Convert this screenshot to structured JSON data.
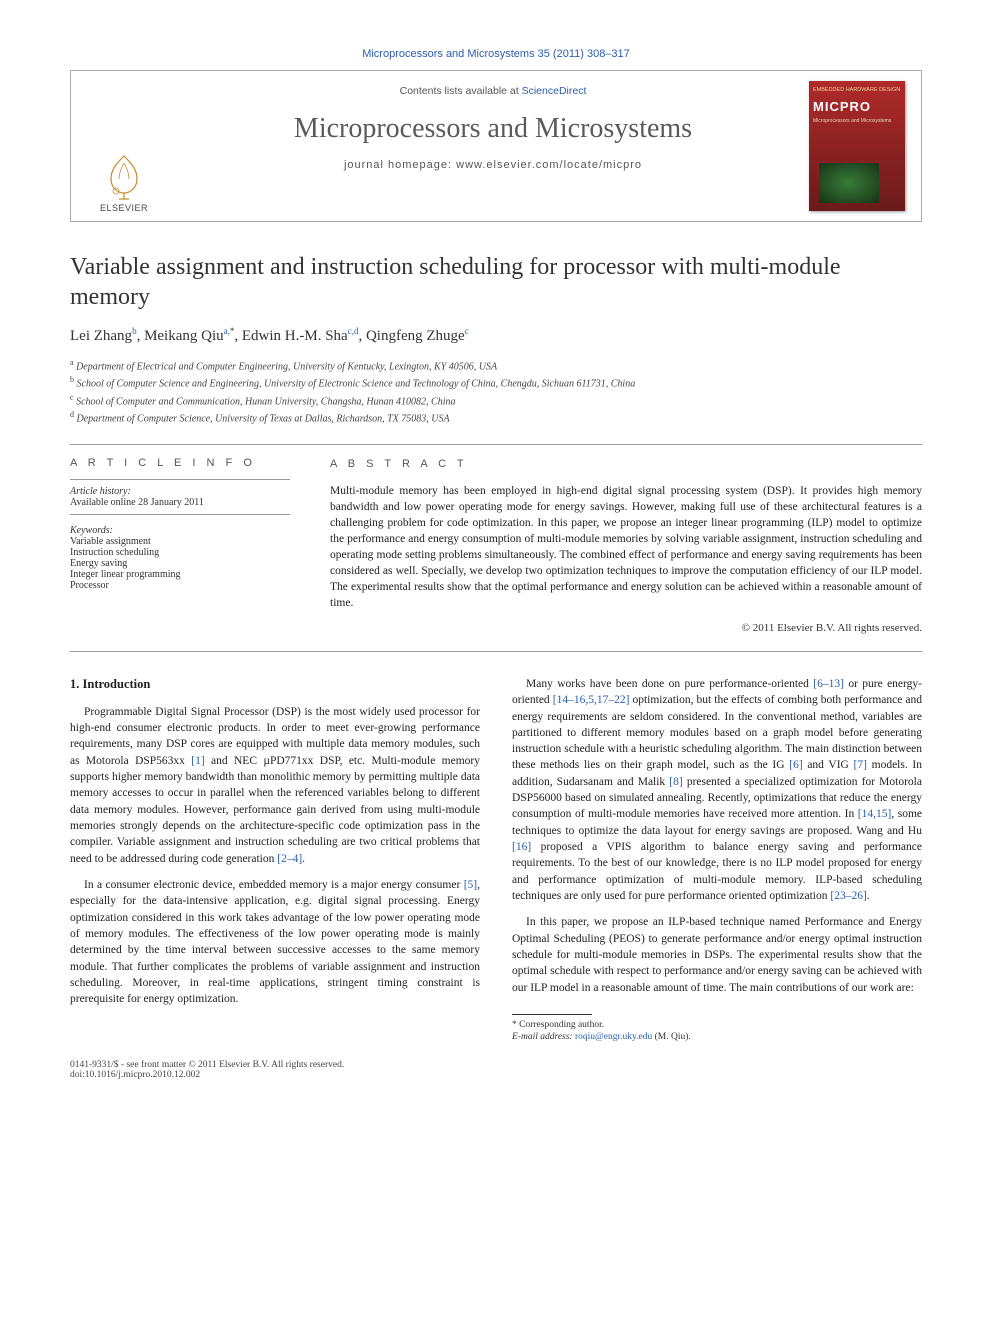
{
  "top_citation": "Microprocessors and Microsystems 35 (2011) 308–317",
  "header": {
    "contents_prefix": "Contents lists available at ",
    "contents_link": "ScienceDirect",
    "journal": "Microprocessors and Microsystems",
    "homepage_prefix": "journal homepage: ",
    "homepage": "www.elsevier.com/locate/micpro",
    "publisher_logo_text": "ELSEVIER",
    "cover_top": "EMBEDDED HARDWARE DESIGN",
    "cover_title": "MICPRO",
    "cover_sub": "Microprocessors and Microsystems"
  },
  "title": "Variable assignment and instruction scheduling for processor with multi-module memory",
  "authors_html_parts": {
    "a1": "Lei Zhang",
    "s1": "b",
    "a2": "Meikang Qiu",
    "s2": "a,",
    "corr": "*",
    "a3": "Edwin H.-M. Sha",
    "s3": "c,d",
    "a4": "Qingfeng Zhuge",
    "s4": "c"
  },
  "affiliations": {
    "a": "Department of Electrical and Computer Engineering, University of Kentucky, Lexington, KY 40506, USA",
    "b": "School of Computer Science and Engineering, University of Electronic Science and Technology of China, Chengdu, Sichuan 611731, China",
    "c": "School of Computer and Communication, Hunan University, Changsha, Hunan 410082, China",
    "d": "Department of Computer Science, University of Texas at Dallas, Richardson, TX 75083, USA"
  },
  "info_heading": "A R T I C L E   I N F O",
  "abstract_heading": "A B S T R A C T",
  "history_label": "Article history:",
  "history_value": "Available online 28 January 2011",
  "keywords_label": "Keywords:",
  "keywords": [
    "Variable assignment",
    "Instruction scheduling",
    "Energy saving",
    "Integer linear programming",
    "Processor"
  ],
  "abstract": "Multi-module memory has been employed in high-end digital signal processing system (DSP). It provides high memory bandwidth and low power operating mode for energy savings. However, making full use of these architectural features is a challenging problem for code optimization. In this paper, we propose an integer linear programming (ILP) model to optimize the performance and energy consumption of multi-module memories by solving variable assignment, instruction scheduling and operating mode setting problems simultaneously. The combined effect of performance and energy saving requirements has been considered as well. Specially, we develop two optimization techniques to improve the computation efficiency of our ILP model. The experimental results show that the optimal performance and energy solution can be achieved within a reasonable amount of time.",
  "copyright": "© 2011 Elsevier B.V. All rights reserved.",
  "section_heading": "1. Introduction",
  "paragraphs": {
    "p1a": "Programmable Digital Signal Processor (DSP) is the most widely used processor for high-end consumer electronic products. In order to meet ever-growing performance requirements, many DSP cores are equipped with multiple data memory modules, such as Motorola DSP563xx ",
    "p1_ref1": "[1]",
    "p1b": " and NEC µPD771xx DSP, etc. Multi-module memory supports higher memory bandwidth than monolithic memory by permitting multiple data memory accesses to occur in parallel when the referenced variables belong to different data memory modules. However, performance gain derived from using multi-module memories strongly depends on the architecture-specific code optimization pass in the compiler. Variable assignment and instruction scheduling are two critical problems that need to be addressed during code generation ",
    "p1_ref2": "[2–4]",
    "p1c": ".",
    "p2a": "In a consumer electronic device, embedded memory is a major energy consumer ",
    "p2_ref1": "[5]",
    "p2b": ", especially for the data-intensive application, e.g. digital signal processing. Energy optimization considered in this work takes advantage of the low power operating mode of memory modules. The effectiveness of the low power operating mode is mainly determined by the time interval between successive accesses to the same memory module. That further complicates the problems of variable assignment and instruction ",
    "p3": "scheduling. Moreover, in real-time applications, stringent timing constraint is prerequisite for energy optimization.",
    "p4a": "Many works have been done on pure performance-oriented ",
    "p4_ref1": "[6–13]",
    "p4b": " or pure energy-oriented ",
    "p4_ref2": "[14–16,5,17–22]",
    "p4c": " optimization, but the effects of combing both performance and energy requirements are seldom considered. In the conventional method, variables are partitioned to different memory modules based on a graph model before generating instruction schedule with a heuristic scheduling algorithm. The main distinction between these methods lies on their graph model, such as the IG ",
    "p4_ref3": "[6]",
    "p4d": " and VIG ",
    "p4_ref4": "[7]",
    "p4e": " models. In addition, Sudarsanam and Malik ",
    "p4_ref5": "[8]",
    "p4f": " presented a specialized optimization for Motorola DSP56000 based on simulated annealing. Recently, optimizations that reduce the energy consumption of multi-module memories have received more attention. In ",
    "p4_ref6": "[14,15]",
    "p4g": ", some techniques to optimize the data layout for energy savings are proposed. Wang and Hu ",
    "p4_ref7": "[16]",
    "p4h": " proposed a VPIS algorithm to balance energy saving and performance requirements. To the best of our knowledge, there is no ILP model proposed for energy and performance optimization of multi-module memory. ILP-based scheduling techniques are only used for pure performance oriented optimization ",
    "p4_ref8": "[23–26]",
    "p4i": ".",
    "p5": "In this paper, we propose an ILP-based technique named Performance and Energy Optimal Scheduling (PEOS) to generate performance and/or energy optimal instruction schedule for multi-module memories in DSPs. The experimental results show that the optimal schedule with respect to performance and/or energy saving can be achieved with our ILP model in a reasonable amount of time. The main contributions of our work are:"
  },
  "footnote": {
    "corr_label": "* Corresponding author.",
    "email_label": "E-mail address:",
    "email": "roqiu@engr.uky.edu",
    "email_who": "(M. Qiu)."
  },
  "footer": {
    "left1": "0141-9331/$ - see front matter © 2011 Elsevier B.V. All rights reserved.",
    "left2": "doi:10.1016/j.micpro.2010.12.002"
  }
}
